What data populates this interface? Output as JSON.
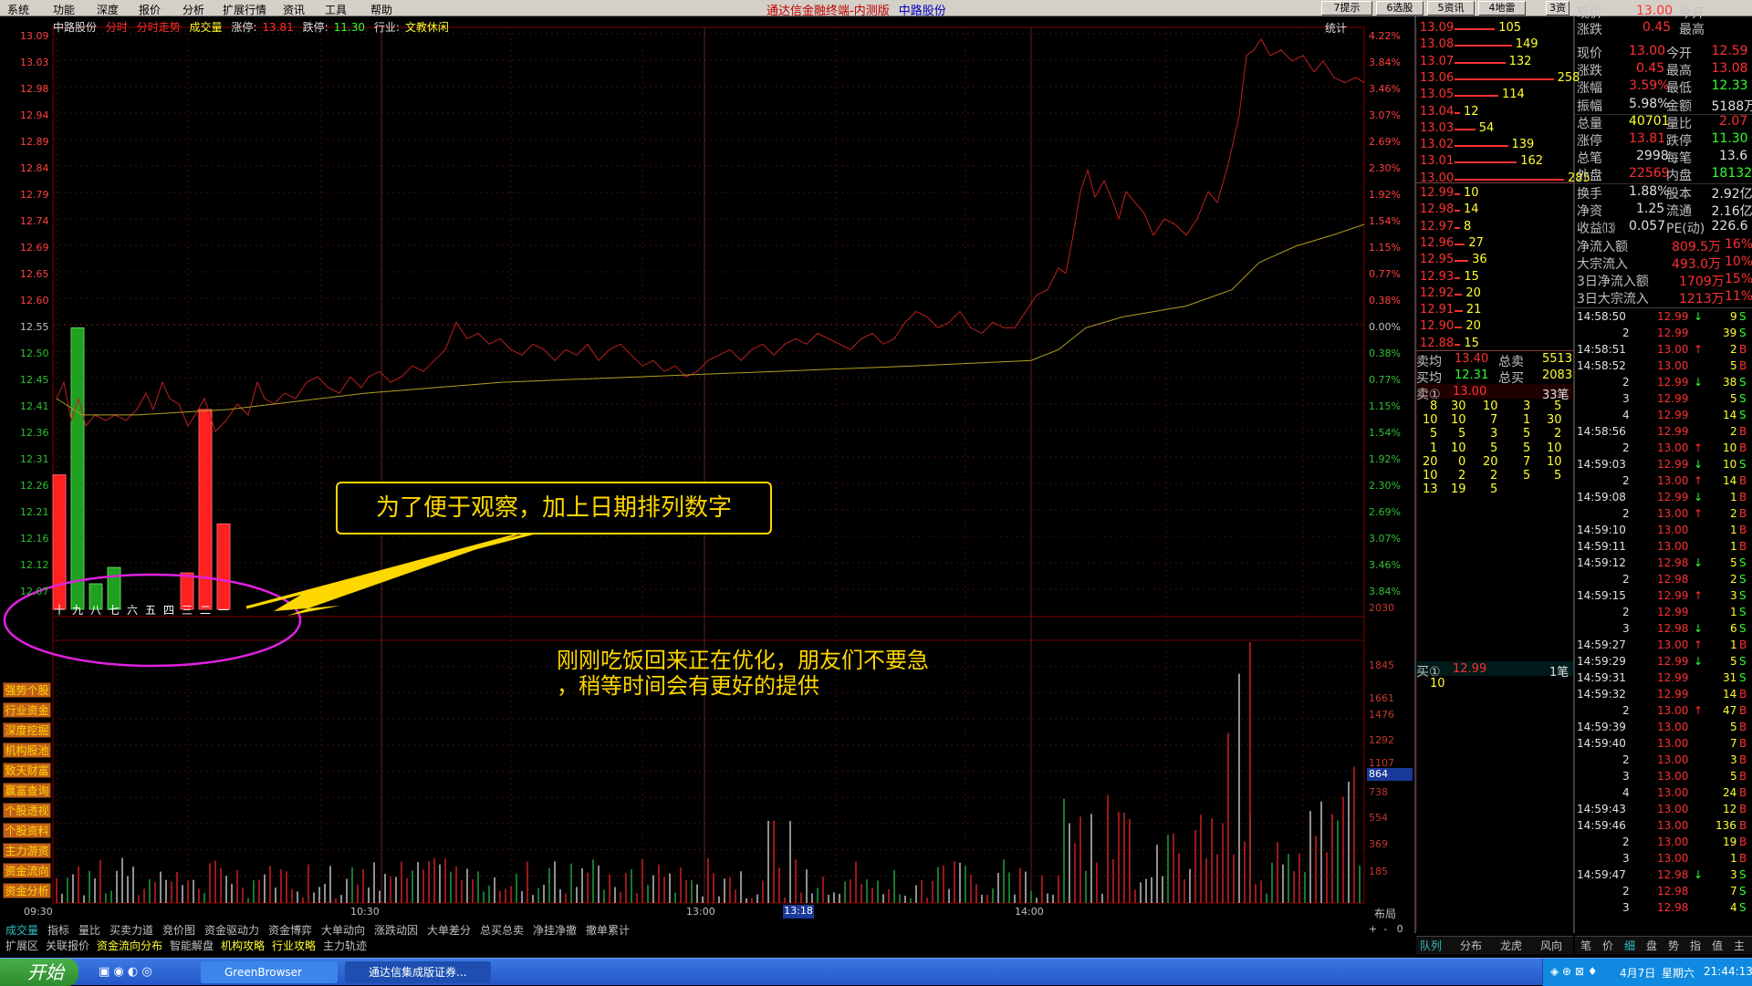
{
  "menu": [
    "系统",
    "功能",
    "深度",
    "报价",
    "分析",
    "扩展行情",
    "资讯",
    "工具",
    "帮助"
  ],
  "app_title": "通达信金融终端-内测版",
  "stock_title": "中路股份",
  "top_buttons": [
    "7提示",
    "6选股",
    "5资讯",
    "4地雷",
    "3资"
  ],
  "chart_info": {
    "name": "中路股份",
    "mode": "分时",
    "mode2": "分时走势",
    "vol_label": "成交量",
    "limit_up_label": "涨停:",
    "limit_up": "13.81",
    "limit_dn_label": "跌停:",
    "limit_dn": "11.30",
    "industry_label": "行业:",
    "industry": "文教休闲",
    "stat": "统计"
  },
  "price_axis": [
    "13.09",
    "13.03",
    "12.98",
    "12.94",
    "12.89",
    "12.84",
    "12.79",
    "12.74",
    "12.69",
    "12.65",
    "12.60",
    "12.55",
    "12.50",
    "12.45",
    "12.41",
    "12.36",
    "12.31",
    "12.26",
    "12.21",
    "12.16",
    "12.12",
    "12.07"
  ],
  "pct_axis": [
    "4.22%",
    "3.84%",
    "3.46%",
    "3.07%",
    "2.69%",
    "2.30%",
    "1.92%",
    "1.54%",
    "1.15%",
    "0.77%",
    "0.38%",
    "0.00%",
    "0.38%",
    "0.77%",
    "1.15%",
    "1.54%",
    "1.92%",
    "2.30%",
    "2.69%",
    "3.07%",
    "3.46%",
    "3.84%"
  ],
  "vol_axis": [
    "2030",
    "1845",
    "1661",
    "1476",
    "1292",
    "1107",
    "864",
    "738",
    "554",
    "369",
    "185"
  ],
  "vol_hl_value": "864",
  "time_axis": [
    "09:30",
    "10:30",
    "13:00",
    "14:00"
  ],
  "time_highlight": "13:18",
  "day_bars": [
    {
      "label": "十",
      "value": 12.28,
      "color": "red"
    },
    {
      "label": "九",
      "value": 12.55,
      "color": "green"
    },
    {
      "label": "八",
      "value": 12.08,
      "color": "green"
    },
    {
      "label": "七",
      "value": 12.11,
      "color": "green"
    },
    {
      "label": "六",
      "value": null,
      "color": "none"
    },
    {
      "label": "五",
      "value": null,
      "color": "none"
    },
    {
      "label": "四",
      "value": null,
      "color": "none"
    },
    {
      "label": "三",
      "value": 12.1,
      "color": "red"
    },
    {
      "label": "二",
      "value": 12.4,
      "color": "red"
    },
    {
      "label": "一",
      "value": 12.19,
      "color": "red"
    }
  ],
  "note1": "为了便于观察，加上日期排列数字",
  "note2": [
    "刚刚吃饭回来正在优化，朋友们不要急",
    "，稍等时间会有更好的提供"
  ],
  "side_buttons": [
    "强势个股",
    "行业资金",
    "深度挖掘",
    "机构股池",
    "致天财富",
    "赢富查询",
    "个股透视",
    "个股资料",
    "主力游资",
    "资金流向",
    "资金分析"
  ],
  "bottom_tabs1": [
    "成交量",
    "指标",
    "量比",
    "买卖力道",
    "竞价图",
    "资金驱动力",
    "资金博弈",
    "大单动向",
    "涨跌动因",
    "大单差分",
    "总买总卖",
    "净挂净撤",
    "撤单累计"
  ],
  "bottom_tabs2": [
    "扩展区",
    "关联报价",
    "资金流向分布",
    "智能解盘",
    "机构攻略",
    "行业攻略",
    "主力轨迹"
  ],
  "layout_label": "布局",
  "sell_book": [
    [
      "13.09",
      "105"
    ],
    [
      "13.08",
      "149"
    ],
    [
      "13.07",
      "132"
    ],
    [
      "13.06",
      "258"
    ],
    [
      "13.05",
      "114"
    ],
    [
      "13.04",
      "12"
    ],
    [
      "13.03",
      "54"
    ],
    [
      "13.02",
      "139"
    ],
    [
      "13.01",
      "162"
    ],
    [
      "13.00",
      "285"
    ]
  ],
  "buy_book": [
    [
      "12.99",
      "10"
    ],
    [
      "12.98",
      "14"
    ],
    [
      "12.97",
      "8"
    ],
    [
      "12.96",
      "27"
    ],
    [
      "12.95",
      "36"
    ],
    [
      "12.93",
      "15"
    ],
    [
      "12.92",
      "20"
    ],
    [
      "12.91",
      "21"
    ],
    [
      "12.90",
      "20"
    ],
    [
      "12.88",
      "15"
    ]
  ],
  "avg_sell_label": "卖均",
  "avg_sell": "13.40",
  "total_sell_label": "总卖",
  "total_sell": "5513",
  "avg_buy_label": "买均",
  "avg_buy": "12.31",
  "total_buy_label": "总买",
  "total_buy": "2083",
  "queue_sell_label": "卖①",
  "queue_sell_price": "13.00",
  "queue_sell_count": "33笔",
  "queue_rows": [
    [
      "8",
      "30",
      "10",
      "3",
      "5"
    ],
    [
      "10",
      "10",
      "7",
      "1",
      "30"
    ],
    [
      "5",
      "5",
      "3",
      "5",
      "2"
    ],
    [
      "1",
      "10",
      "5",
      "5",
      "10"
    ],
    [
      "20",
      "0",
      "20",
      "7",
      "10"
    ],
    [
      "10",
      "2",
      "2",
      "5",
      "5"
    ],
    [
      "13",
      "19",
      "5",
      "",
      ""
    ]
  ],
  "queue_buy_label": "买①",
  "queue_buy_price": "12.99",
  "queue_buy_count": "1笔",
  "queue_buy_row": "10",
  "mid_tabs": [
    "队列",
    "分布",
    "龙虎",
    "风向"
  ],
  "quote": [
    [
      "现价",
      "13.00",
      "今开",
      "12.59"
    ],
    [
      "涨跌",
      "0.45",
      "最高",
      "13.08"
    ],
    [
      "涨幅",
      "3.59%",
      "最低",
      "12.33"
    ],
    [
      "振幅",
      "5.98%",
      "金额",
      "5188万"
    ],
    [
      "总量",
      "40701",
      "量比",
      "2.07"
    ],
    [
      "涨停",
      "13.81",
      "跌停",
      "11.30"
    ],
    [
      "总笔",
      "2998",
      "每笔",
      "13.6"
    ],
    [
      "外盘",
      "22569",
      "内盘",
      "18132"
    ],
    [
      "换手",
      "1.88%",
      "股本",
      "2.92亿"
    ],
    [
      "净资",
      "1.25",
      "流通",
      "2.16亿"
    ],
    [
      "收益⒀",
      "0.057",
      "PE(动)",
      "226.6"
    ]
  ],
  "flow": [
    [
      "净流入额",
      "809.5万",
      "16%"
    ],
    [
      "大宗流入",
      "493.0万",
      "10%"
    ],
    [
      "3日净流入额",
      "1709万",
      "15%"
    ],
    [
      "3日大宗流入",
      "1213万",
      "11%"
    ]
  ],
  "ticks": [
    [
      "14:58:50",
      "12.99",
      "↓",
      "9",
      "S"
    ],
    [
      "2",
      "12.99",
      "",
      "39",
      "S"
    ],
    [
      "14:58:51",
      "13.00",
      "↑",
      "2",
      "B"
    ],
    [
      "14:58:52",
      "13.00",
      "",
      "5",
      "B"
    ],
    [
      "2",
      "12.99",
      "↓",
      "38",
      "S"
    ],
    [
      "3",
      "12.99",
      "",
      "5",
      "S"
    ],
    [
      "4",
      "12.99",
      "",
      "14",
      "S"
    ],
    [
      "14:58:56",
      "12.99",
      "",
      "2",
      "B"
    ],
    [
      "2",
      "13.00",
      "↑",
      "10",
      "B"
    ],
    [
      "14:59:03",
      "12.99",
      "↓",
      "10",
      "S"
    ],
    [
      "2",
      "13.00",
      "↑",
      "14",
      "B"
    ],
    [
      "14:59:08",
      "12.99",
      "↓",
      "1",
      "B"
    ],
    [
      "2",
      "13.00",
      "↑",
      "2",
      "B"
    ],
    [
      "14:59:10",
      "13.00",
      "",
      "1",
      "B"
    ],
    [
      "14:59:11",
      "13.00",
      "",
      "1",
      "B"
    ],
    [
      "14:59:12",
      "12.98",
      "↓",
      "5",
      "S"
    ],
    [
      "2",
      "12.98",
      "",
      "2",
      "S"
    ],
    [
      "14:59:15",
      "12.99",
      "↑",
      "3",
      "S"
    ],
    [
      "2",
      "12.99",
      "",
      "1",
      "S"
    ],
    [
      "3",
      "12.98",
      "↓",
      "6",
      "S"
    ],
    [
      "14:59:27",
      "13.00",
      "↑",
      "1",
      "B"
    ],
    [
      "14:59:29",
      "12.99",
      "↓",
      "5",
      "S"
    ],
    [
      "14:59:31",
      "12.99",
      "",
      "31",
      "S"
    ],
    [
      "14:59:32",
      "12.99",
      "",
      "14",
      "B"
    ],
    [
      "2",
      "13.00",
      "↑",
      "47",
      "B"
    ],
    [
      "14:59:39",
      "13.00",
      "",
      "5",
      "B"
    ],
    [
      "14:59:40",
      "13.00",
      "",
      "7",
      "B"
    ],
    [
      "2",
      "13.00",
      "",
      "3",
      "B"
    ],
    [
      "3",
      "13.00",
      "",
      "5",
      "B"
    ],
    [
      "4",
      "13.00",
      "",
      "24",
      "B"
    ],
    [
      "14:59:43",
      "13.00",
      "",
      "12",
      "B"
    ],
    [
      "14:59:46",
      "13.00",
      "",
      "136",
      "B"
    ],
    [
      "2",
      "13.00",
      "",
      "19",
      "B"
    ],
    [
      "3",
      "13.00",
      "",
      "1",
      "B"
    ],
    [
      "14:59:47",
      "12.98",
      "↓",
      "3",
      "S"
    ],
    [
      "2",
      "12.98",
      "",
      "7",
      "S"
    ],
    [
      "3",
      "12.98",
      "",
      "4",
      "S"
    ]
  ],
  "right_tabs": [
    "笔",
    "价",
    "细",
    "盘",
    "势",
    "指",
    "值",
    "主"
  ],
  "taskbar": {
    "start": "开始",
    "items": [
      "GreenBrowser",
      "通达信集成版证券..."
    ],
    "date": "4月7日",
    "weekday": "星期六",
    "time": "21:44:13"
  }
}
